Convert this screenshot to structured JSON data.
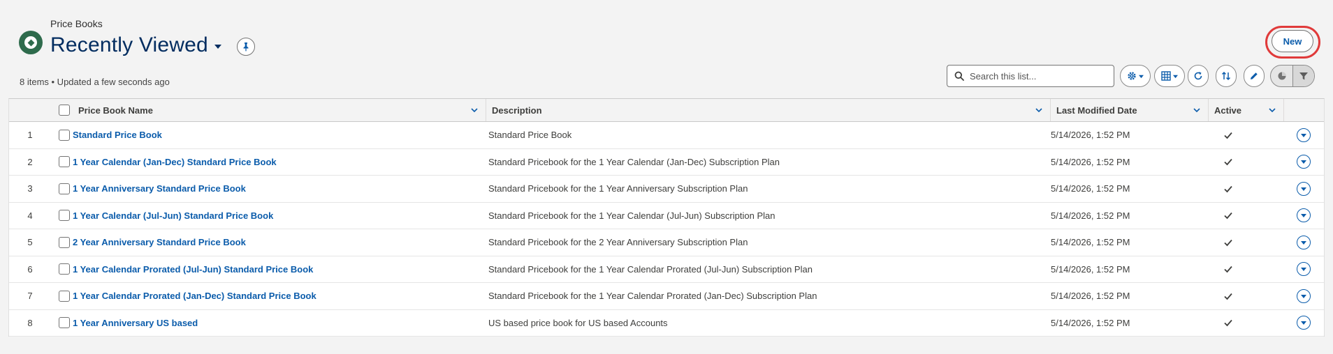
{
  "header": {
    "object_label": "Price Books",
    "list_view_title": "Recently Viewed",
    "status_text": "8 items • Updated a few seconds ago",
    "new_button_label": "New"
  },
  "search": {
    "placeholder": "Search this list...",
    "value": ""
  },
  "toolbar": {
    "icons": [
      "settings-icon",
      "table-icon",
      "refresh-icon",
      "sort-icon",
      "edit-icon",
      "chart-icon",
      "filter-icon"
    ]
  },
  "columns": {
    "name": "Price Book Name",
    "description": "Description",
    "modified": "Last Modified Date",
    "active": "Active"
  },
  "rows": [
    {
      "num": "1",
      "name": "Standard Price Book",
      "description": "Standard Price Book",
      "modified": "5/14/2026, 1:52 PM",
      "active": true
    },
    {
      "num": "2",
      "name": "1 Year Calendar (Jan-Dec) Standard Price Book",
      "description": "Standard Pricebook for the 1 Year Calendar (Jan-Dec) Subscription Plan",
      "modified": "5/14/2026, 1:52 PM",
      "active": true
    },
    {
      "num": "3",
      "name": "1 Year Anniversary Standard Price Book",
      "description": "Standard Pricebook for the 1 Year Anniversary Subscription Plan",
      "modified": "5/14/2026, 1:52 PM",
      "active": true
    },
    {
      "num": "4",
      "name": "1 Year Calendar (Jul-Jun) Standard Price Book",
      "description": "Standard Pricebook for the 1 Year Calendar (Jul-Jun) Subscription Plan",
      "modified": "5/14/2026, 1:52 PM",
      "active": true
    },
    {
      "num": "5",
      "name": "2 Year Anniversary Standard Price Book",
      "description": "Standard Pricebook for the 2 Year Anniversary Subscription Plan",
      "modified": "5/14/2026, 1:52 PM",
      "active": true
    },
    {
      "num": "6",
      "name": "1 Year Calendar Prorated (Jul-Jun) Standard Price Book",
      "description": "Standard Pricebook for the 1 Year Calendar Prorated (Jul-Jun) Subscription Plan",
      "modified": "5/14/2026, 1:52 PM",
      "active": true
    },
    {
      "num": "7",
      "name": "1 Year Calendar Prorated (Jan-Dec) Standard Price Book",
      "description": "Standard Pricebook for the 1 Year Calendar Prorated (Jan-Dec) Subscription Plan",
      "modified": "5/14/2026, 1:52 PM",
      "active": true
    },
    {
      "num": "8",
      "name": "1 Year Anniversary US based",
      "description": "US based price book for US based Accounts",
      "modified": "5/14/2026, 1:52 PM",
      "active": true
    }
  ],
  "colors": {
    "brand_icon": "#2e6b4c",
    "title": "#032d60",
    "link": "#0b5cab",
    "highlight_ring": "#e03a3a"
  }
}
